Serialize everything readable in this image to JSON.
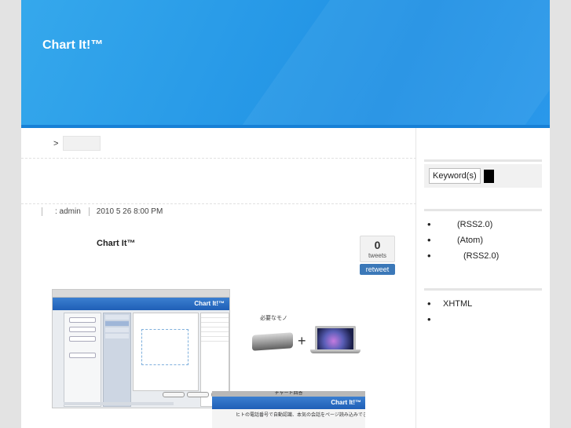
{
  "site": {
    "title": "Chart It!™"
  },
  "breadcrumb": {
    "separator": ">"
  },
  "post": {
    "author": ": admin",
    "date": "2010 5 26  8:00 PM",
    "title": "Chart It™",
    "tweet_count": "0",
    "tweet_unit": "tweets",
    "retweet_label": "retweet"
  },
  "screenshots": {
    "app_title": "Chart It!™",
    "hardware_label": "必要なモノ",
    "hardware_plus": "+",
    "second_top_label": "チャート回答",
    "second_title": "Chart It!™",
    "second_caption": "ヒトの電話番号で自動認識、本気の会話をページ読み込みできます"
  },
  "sidebar": {
    "search_button_label": "Keyword(s)",
    "feeds": [
      {
        "label": "(RSS2.0)"
      },
      {
        "label": "(Atom)"
      },
      {
        "label": "(RSS2.0)"
      }
    ],
    "meta_items": [
      {
        "label": "XHTML"
      },
      {
        "label": ""
      }
    ]
  },
  "colors": {
    "header_blue": "#2a9ce8",
    "retweet_blue": "#3b78b8",
    "page_bg": "#e3e3e3"
  }
}
